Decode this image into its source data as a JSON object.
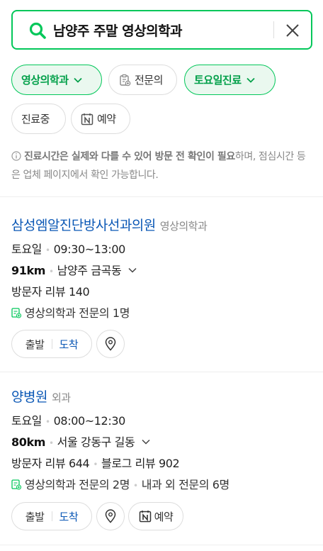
{
  "search": {
    "query": "남양주 주말 영상의학과"
  },
  "filters": {
    "radiology": "영상의학과",
    "specialist": "전문의",
    "saturday": "토요일진료",
    "open_now": "진료중",
    "booking": "예약"
  },
  "notice": {
    "bold": "진료시간은 실제와 다를 수 있어 방문 전 확인이 필요",
    "rest": "하며, 점심시간 등은 업체 페이지에서 확인 가능합니다."
  },
  "results": [
    {
      "name": "삼성엠알진단방사선과의원",
      "category": "영상의학과",
      "day": "토요일",
      "hours": "09:30~13:00",
      "distance": "91km",
      "address": "남양주 금곡동",
      "visitor_reviews": "방문자 리뷰 140",
      "blog_reviews": "",
      "specialists": "영상의학과 전문의 1명",
      "specialists_extra": "",
      "depart": "출발",
      "arrive": "도착",
      "booking": ""
    },
    {
      "name": "양병원",
      "category": "외과",
      "day": "토요일",
      "hours": "08:00~12:30",
      "distance": "80km",
      "address": "서울 강동구 길동",
      "visitor_reviews": "방문자 리뷰 644",
      "blog_reviews": "블로그 리뷰 902",
      "specialists": "영상의학과 전문의 2명",
      "specialists_extra": "내과 외 전문의 6명",
      "depart": "출발",
      "arrive": "도착",
      "booking": "예약"
    }
  ],
  "colors": {
    "accent": "#03c75a",
    "link": "#0a57b5"
  }
}
